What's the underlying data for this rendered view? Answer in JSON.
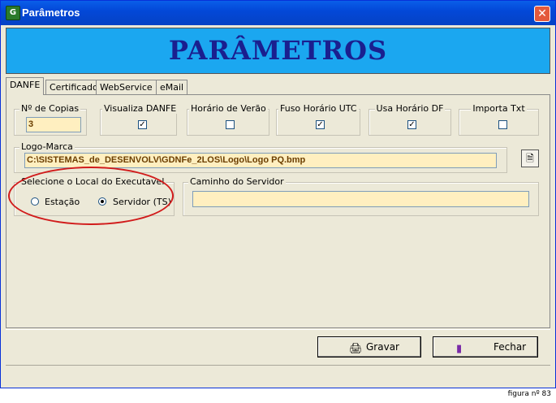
{
  "window": {
    "title": "Parâmetros",
    "icon": "app-icon",
    "close_label": "✕"
  },
  "banner": {
    "title": "PARÂMETROS"
  },
  "tabs": [
    {
      "label": "DANFE",
      "active": true
    },
    {
      "label": "Certificado"
    },
    {
      "label": "WebService"
    },
    {
      "label": "eMail"
    }
  ],
  "options": {
    "copias": {
      "label": "Nº de Copias",
      "value": "3"
    },
    "visualiza_danfe": {
      "label": "Visualiza DANFE",
      "checked": "✓"
    },
    "horario_verao": {
      "label": "Horário de Verão",
      "checked": ""
    },
    "fuso_horario": {
      "label": "Fuso Horário UTC",
      "checked": "✓"
    },
    "usa_horario_df": {
      "label": "Usa Horário DF",
      "checked": "✓"
    },
    "importa_txt": {
      "label": "Importa Txt",
      "checked": ""
    }
  },
  "logo": {
    "label": "Logo-Marca",
    "path": "C:\\SISTEMAS_de_DESENVOLV\\GDNFe_2LOS\\Logo\\Logo PQ.bmp",
    "browse_icon": "file-icon"
  },
  "local": {
    "label": "Selecione o Local do Executavel",
    "options": [
      {
        "label": "Estação",
        "selected": false
      },
      {
        "label": "Servidor (TS)",
        "selected": true
      }
    ]
  },
  "servidor": {
    "label": "Caminho do Servidor",
    "value": ""
  },
  "buttons": {
    "gravar": "Gravar",
    "fechar": "Fechar"
  },
  "caption": "figura nº 83",
  "colors": {
    "banner": "#1BA7F0",
    "banner_text": "#1A1F8F",
    "field_bg": "#FFEFC0",
    "highlight": "#D11B1B"
  }
}
